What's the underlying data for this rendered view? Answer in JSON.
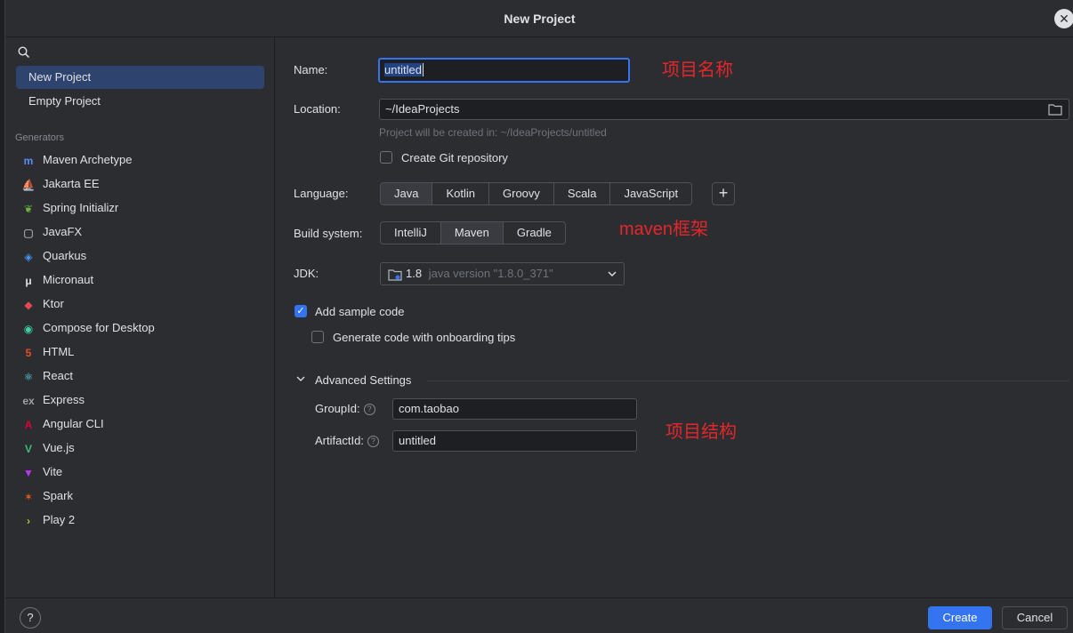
{
  "window": {
    "title": "New Project"
  },
  "left": {
    "search_placeholder": "",
    "project_types": [
      {
        "label": "New Project",
        "selected": true
      },
      {
        "label": "Empty Project",
        "selected": false
      }
    ],
    "generators_label": "Generators",
    "generators": [
      {
        "label": "Maven Archetype",
        "icon": "maven-icon",
        "glyph": "m",
        "color": "#5b8cff"
      },
      {
        "label": "Jakarta EE",
        "icon": "jakarta-ee-icon",
        "glyph": "⛵",
        "color": "#f29111"
      },
      {
        "label": "Spring Initializr",
        "icon": "spring-icon",
        "glyph": "❦",
        "color": "#6db33f"
      },
      {
        "label": "JavaFX",
        "icon": "javafx-icon",
        "glyph": "▢",
        "color": "#dfe1e5"
      },
      {
        "label": "Quarkus",
        "icon": "quarkus-icon",
        "glyph": "◈",
        "color": "#4695eb"
      },
      {
        "label": "Micronaut",
        "icon": "micronaut-icon",
        "glyph": "μ",
        "color": "#dfe1e5"
      },
      {
        "label": "Ktor",
        "icon": "ktor-icon",
        "glyph": "◆",
        "color": "#e44857"
      },
      {
        "label": "Compose for Desktop",
        "icon": "compose-icon",
        "glyph": "◉",
        "color": "#3fd0a3"
      },
      {
        "label": "HTML",
        "icon": "html5-icon",
        "glyph": "5",
        "color": "#e44d26"
      },
      {
        "label": "React",
        "icon": "react-icon",
        "glyph": "⚛",
        "color": "#61dafb"
      },
      {
        "label": "Express",
        "icon": "express-icon",
        "glyph": "ex",
        "color": "#9da0a8"
      },
      {
        "label": "Angular CLI",
        "icon": "angular-icon",
        "glyph": "A",
        "color": "#dd0031"
      },
      {
        "label": "Vue.js",
        "icon": "vue-icon",
        "glyph": "V",
        "color": "#41b883"
      },
      {
        "label": "Vite",
        "icon": "vite-icon",
        "glyph": "▼",
        "color": "#bd34fe"
      },
      {
        "label": "Spark",
        "icon": "spark-icon",
        "glyph": "✶",
        "color": "#e25a1c"
      },
      {
        "label": "Play 2",
        "icon": "play-icon",
        "glyph": "›",
        "color": "#92d13d"
      }
    ]
  },
  "form": {
    "name_label": "Name:",
    "name_value": "untitled",
    "location_label": "Location:",
    "location_value": "~/IdeaProjects",
    "location_hint": "Project will be created in: ~/IdeaProjects/untitled",
    "git_label": "Create Git repository",
    "git_checked": false,
    "language_label": "Language:",
    "languages": [
      {
        "label": "Java",
        "active": true
      },
      {
        "label": "Kotlin",
        "active": false
      },
      {
        "label": "Groovy",
        "active": false
      },
      {
        "label": "Scala",
        "active": false
      },
      {
        "label": "JavaScript",
        "active": false
      }
    ],
    "add_language": "+",
    "build_label": "Build system:",
    "build_systems": [
      {
        "label": "IntelliJ",
        "active": false
      },
      {
        "label": "Maven",
        "active": true
      },
      {
        "label": "Gradle",
        "active": false
      }
    ],
    "jdk_label": "JDK:",
    "jdk_version": "1.8",
    "jdk_detail": "java version \"1.8.0_371\"",
    "sample_code_label": "Add sample code",
    "sample_code_checked": true,
    "onboarding_label": "Generate code with onboarding tips",
    "onboarding_checked": false,
    "advanced_label": "Advanced Settings",
    "group_id_label": "GroupId:",
    "group_id_value": "com.taobao",
    "artifact_id_label": "ArtifactId:",
    "artifact_id_value": "untitled"
  },
  "annotations": {
    "name_note": "项目名称",
    "maven_note": "maven框架",
    "structure_note": "项目结构"
  },
  "footer": {
    "help": "?",
    "create_label": "Create",
    "cancel_label": "Cancel"
  },
  "colors": {
    "accent": "#3574f0",
    "selection": "#2e436e",
    "annotation": "#e5262b",
    "background": "#2b2d30"
  }
}
